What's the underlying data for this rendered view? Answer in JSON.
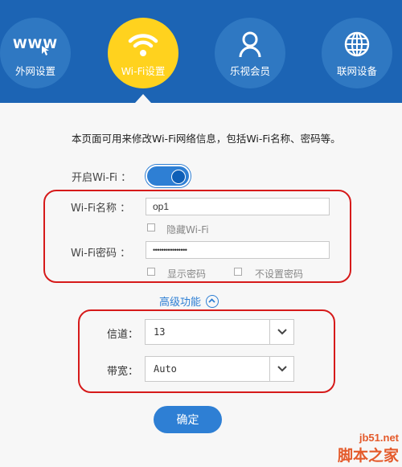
{
  "nav": {
    "tabs": [
      {
        "label": "外网设置",
        "icon": "www-icon"
      },
      {
        "label": "Wi-Fi设置",
        "icon": "wifi-icon"
      },
      {
        "label": "乐视会员",
        "icon": "user-icon"
      },
      {
        "label": "联网设备",
        "icon": "globe-icon"
      }
    ],
    "active_tab": "Wi-Fi设置",
    "www_text": "WWW"
  },
  "content": {
    "description": "本页面可用来修改Wi-Fi网络信息，包括Wi-Fi名称、密码等。",
    "enable_wifi_label": "开启Wi-Fi ：",
    "enable_wifi_on": true,
    "ssid_label": "Wi-Fi名称 ：",
    "ssid_value": "op1",
    "hide_wifi_label": "隐藏Wi-Fi",
    "password_label": "Wi-Fi密码 ：",
    "password_value": "••••••••••••••••",
    "show_password_label": "显示密码",
    "no_password_label": "不设置密码",
    "advanced_label": "高级功能",
    "channel_label": "信道：",
    "channel_value": "13",
    "bandwidth_label": "带宽：",
    "bandwidth_value": "Auto",
    "confirm_label": "确定"
  },
  "watermark": {
    "url": "jb51.net",
    "name": "脚本之家"
  },
  "colors": {
    "header_blue": "#1c64b4",
    "active_yellow": "#ffd21e",
    "accent_blue": "#2e7fd4",
    "annotation_red": "#d61a1a"
  }
}
